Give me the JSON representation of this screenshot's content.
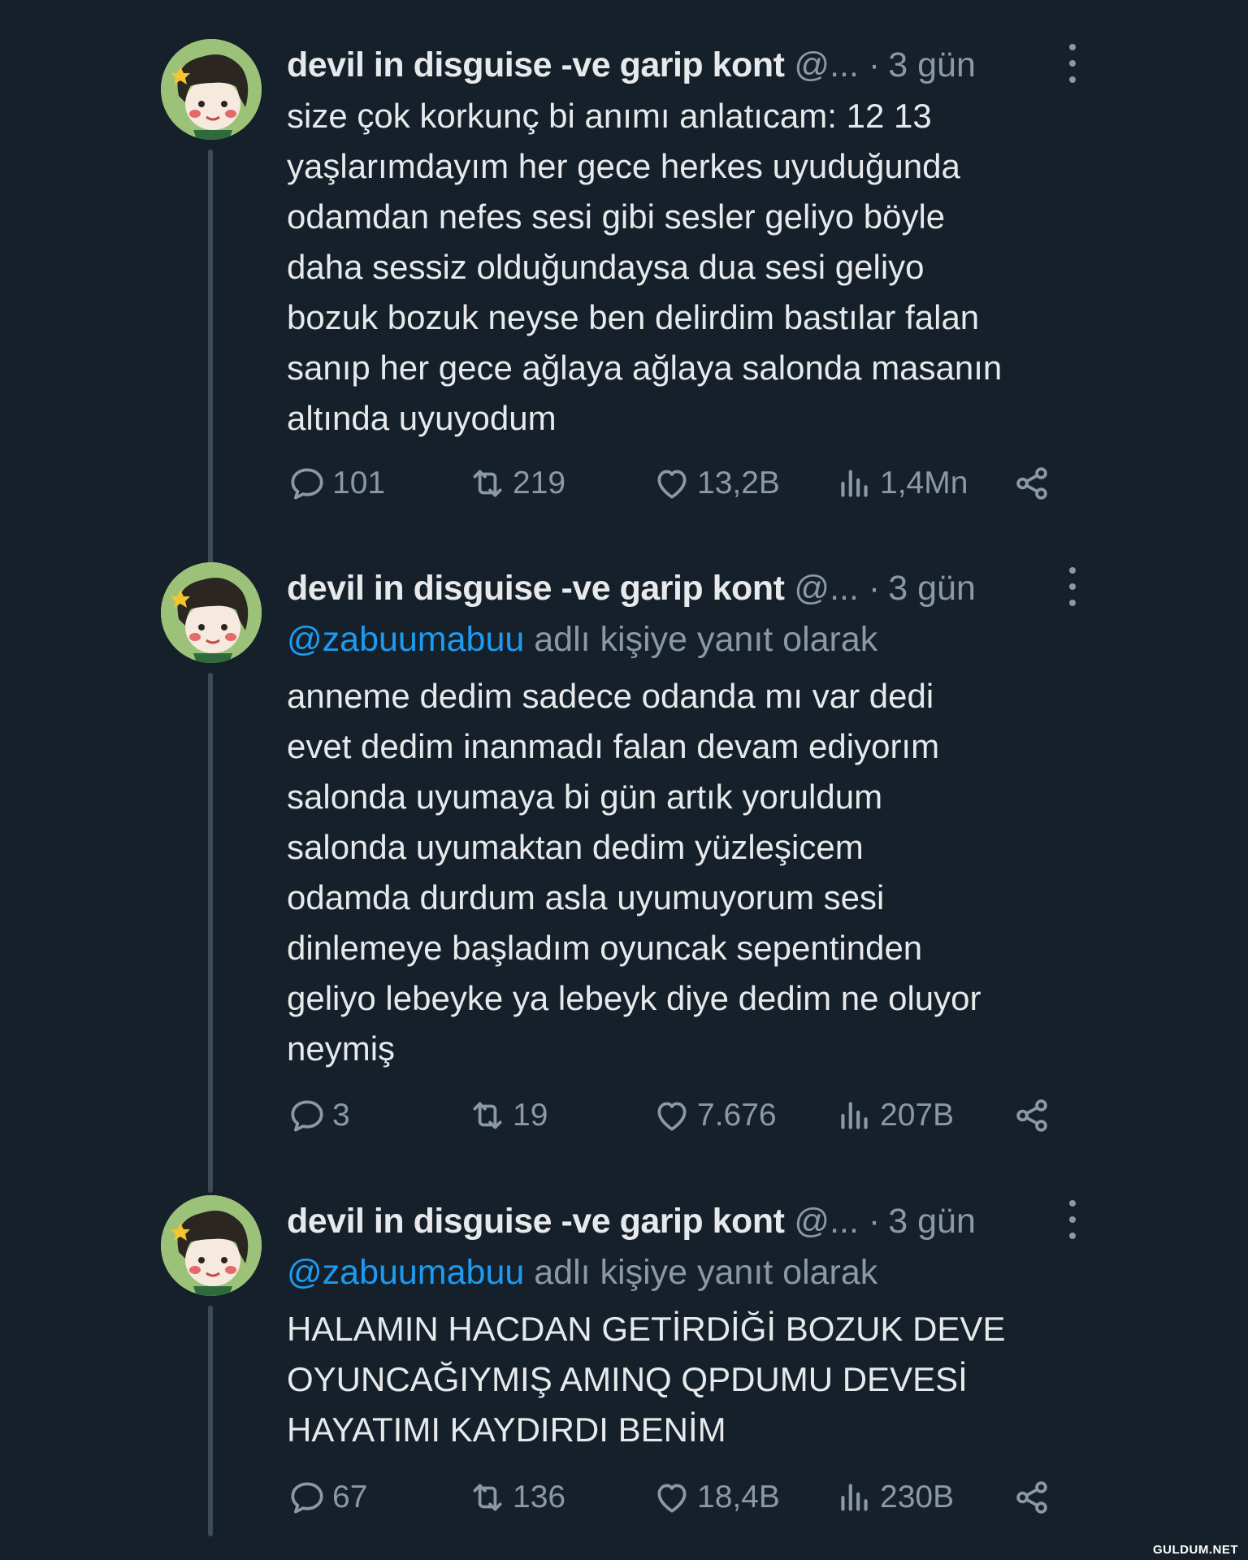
{
  "tweets": [
    {
      "name": "devil in disguise -ve garip kont",
      "handle": "@...",
      "dot": "·",
      "time": "3 gün",
      "reply_mention": "",
      "reply_suffix": "",
      "lines": [
        "size çok korkunç bi anımı anlatıcam: 12 13",
        "yaşlarımdayım her gece herkes uyuduğunda",
        "odamdan nefes sesi gibi sesler geliyo böyle",
        "daha sessiz olduğundaysa dua sesi geliyo",
        "bozuk bozuk neyse ben delirdim bastılar falan",
        "sanıp her gece ağlaya ağlaya salonda masanın",
        "altında uyuyodum"
      ],
      "replies": "101",
      "retweets": "219",
      "likes": "13,2B",
      "views": "1,4Mn"
    },
    {
      "name": "devil in disguise -ve garip kont",
      "handle": "@...",
      "dot": "·",
      "time": "3 gün",
      "reply_mention": "@zabuumabuu",
      "reply_suffix": " adlı kişiye yanıt olarak",
      "lines": [
        "anneme dedim sadece odanda mı var dedi",
        "evet dedim inanmadı falan devam ediyorım",
        "salonda uyumaya bi gün artık yoruldum",
        "salonda uyumaktan dedim yüzleşicem",
        "odamda durdum asla uyumuyorum sesi",
        "dinlemeye başladım oyuncak sepentinden",
        "geliyo lebeyke ya lebeyk diye dedim ne oluyor",
        "neymiş"
      ],
      "replies": "3",
      "retweets": "19",
      "likes": "7.676",
      "views": "207B"
    },
    {
      "name": "devil in disguise -ve garip kont",
      "handle": "@...",
      "dot": "·",
      "time": "3 gün",
      "reply_mention": "@zabuumabuu",
      "reply_suffix": " adlı kişiye yanıt olarak",
      "lines": [
        "HALAMIN HACDAN GETİRDİĞİ BOZUK DEVE",
        "OYUNCAĞIYMIŞ AMINQ QPDUMU DEVESİ",
        "HAYATIMI KAYDIRDI BENİM"
      ],
      "replies": "67",
      "retweets": "136",
      "likes": "18,4B",
      "views": "230B"
    }
  ],
  "icons": {
    "reply": "reply-icon",
    "retweet": "retweet-icon",
    "like": "heart-icon",
    "views": "views-icon",
    "share": "share-icon",
    "more": "more-icon"
  },
  "colors": {
    "background": "#15202b",
    "text": "#e7e9ea",
    "secondary": "#8b98a5",
    "link": "#1d9bf0",
    "thread_line": "#3d4a58"
  },
  "watermark": "GULDUM.NET"
}
